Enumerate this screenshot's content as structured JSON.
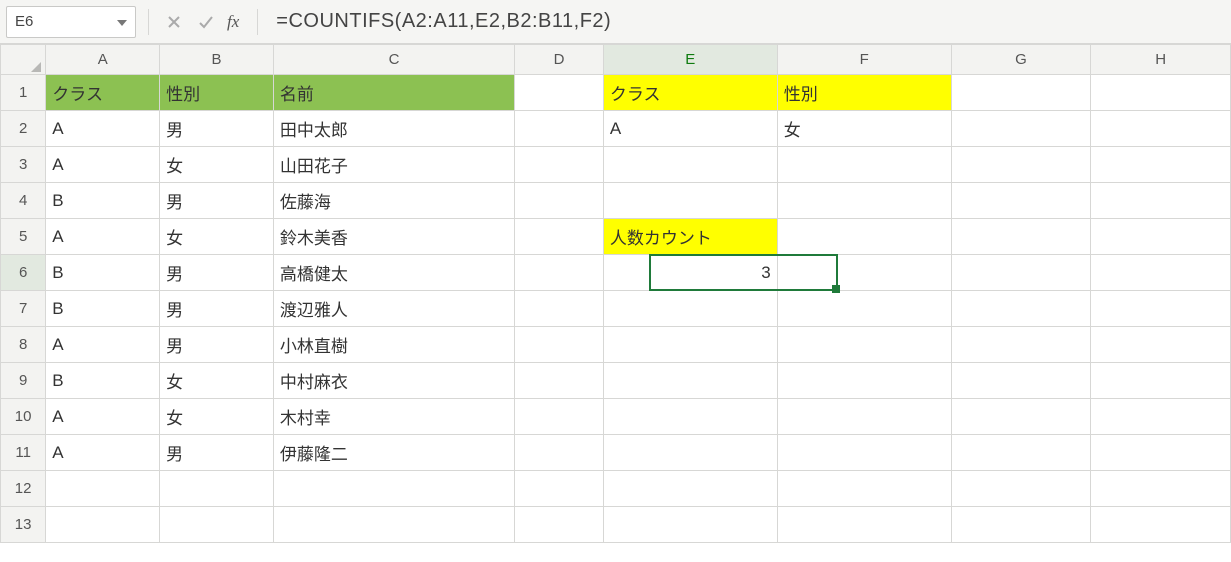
{
  "name_box": "E6",
  "formula": "=COUNTIFS(A2:A11,E2,B2:B11,F2)",
  "fx_label": "fx",
  "col_headers": [
    "A",
    "B",
    "C",
    "D",
    "E",
    "F",
    "G",
    "H"
  ],
  "row_headers": [
    "1",
    "2",
    "3",
    "4",
    "5",
    "6",
    "7",
    "8",
    "9",
    "10",
    "11",
    "12",
    "13"
  ],
  "selected": {
    "col": "E",
    "row": "6"
  },
  "left_table": {
    "header": {
      "class_label": "クラス",
      "gender_label": "性別",
      "name_label": "名前"
    },
    "rows": [
      {
        "class": "A",
        "gender": "男",
        "name": "田中太郎"
      },
      {
        "class": "A",
        "gender": "女",
        "name": "山田花子"
      },
      {
        "class": "B",
        "gender": "男",
        "name": "佐藤海"
      },
      {
        "class": "A",
        "gender": "女",
        "name": "鈴木美香"
      },
      {
        "class": "B",
        "gender": "男",
        "name": "高橋健太"
      },
      {
        "class": "B",
        "gender": "男",
        "name": "渡辺雅人"
      },
      {
        "class": "A",
        "gender": "男",
        "name": "小林直樹"
      },
      {
        "class": "B",
        "gender": "女",
        "name": "中村麻衣"
      },
      {
        "class": "A",
        "gender": "女",
        "name": "木村幸"
      },
      {
        "class": "A",
        "gender": "男",
        "name": "伊藤隆二"
      }
    ]
  },
  "criteria": {
    "header": {
      "class_label": "クラス",
      "gender_label": "性別"
    },
    "class_value": "A",
    "gender_value": "女"
  },
  "count": {
    "label": "人数カウント",
    "value": "3"
  }
}
